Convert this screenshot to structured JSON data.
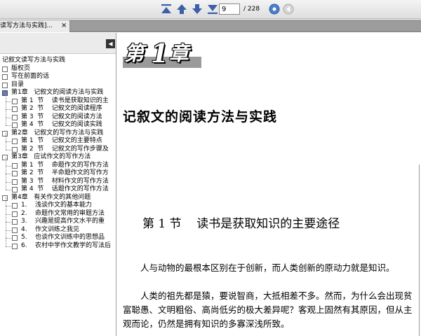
{
  "toolbar": {
    "buttons": [
      {
        "name": "first-page-icon",
        "color": "#3c5fa8"
      },
      {
        "name": "previous-page-icon",
        "color": "#3c5fa8"
      },
      {
        "name": "next-page-icon",
        "color": "#3c5fa8"
      },
      {
        "name": "last-page-icon",
        "color": "#3c5fa8"
      }
    ],
    "current_page": "9",
    "total_pages": "/ 228",
    "go_button_icon": "go-page-icon",
    "back_button_icon": "back-icon"
  },
  "tab": {
    "title": "读写方法与实践]...",
    "close_symbol": "×"
  },
  "sidebar": {
    "collapse_symbol": "◀",
    "outline": [
      {
        "text": "记叙文读写方法与实践",
        "level": 0,
        "box": false
      },
      {
        "text": "版权页",
        "level": 0,
        "box": true
      },
      {
        "text": "写在前面的话",
        "level": 0,
        "box": true
      },
      {
        "text": "目录",
        "level": 0,
        "box": true
      },
      {
        "text": "第1章   记叙文的阅读方法与实践",
        "level": 0,
        "box": true,
        "selected": true
      },
      {
        "text": "第 1  节    读书是获取知识的主",
        "level": 1,
        "box": true
      },
      {
        "text": "第 2  节    记叙文的阅读程序",
        "level": 1,
        "box": true
      },
      {
        "text": "第 3  节    记叙文的阅读方法",
        "level": 1,
        "box": true
      },
      {
        "text": "第 4  节    记叙文的阅读实践",
        "level": 1,
        "box": true
      },
      {
        "text": "第2章   记叙文的写作方法与实践",
        "level": 0,
        "box": true
      },
      {
        "text": "第 1  节    记叙文的主要特点",
        "level": 1,
        "box": true
      },
      {
        "text": "第 2  节    记叙文的写作步骤及",
        "level": 1,
        "box": true
      },
      {
        "text": "第3章   应试作文的写作方法",
        "level": 0,
        "box": true
      },
      {
        "text": "第 1  节    命题作文的写作方法",
        "level": 1,
        "box": true
      },
      {
        "text": "第 2  节    半命题作文的写作方",
        "level": 1,
        "box": true
      },
      {
        "text": "第 3  节    材料作文的写作方法",
        "level": 1,
        "box": true
      },
      {
        "text": "第 4  节    话题作文的写作方法",
        "level": 1,
        "box": true
      },
      {
        "text": "第4章   有关作文的其他问题",
        "level": 0,
        "box": true
      },
      {
        "text": "1.    浅谈作文的基本能力",
        "level": 1,
        "box": true
      },
      {
        "text": "2.    命题作文常用的审题方法",
        "level": 1,
        "box": true
      },
      {
        "text": "3.    兴趣是提高作文水平的重",
        "level": 1,
        "box": true
      },
      {
        "text": "4.    作文训练之我见",
        "level": 1,
        "box": true
      },
      {
        "text": "5.    也谈作文训练中的思想品",
        "level": 1,
        "box": true
      },
      {
        "text": "6.    农村中学作文教学的写法后",
        "level": 1,
        "box": true
      }
    ]
  },
  "document": {
    "chapter_badge": {
      "char1": "第",
      "char2": "1",
      "char3": "章"
    },
    "chapter_title": "记叙文的阅读方法与实践",
    "section_title": "第 1 节    读书是获取知识的主要途径",
    "paragraphs": [
      "人与动物的最根本区别在于创新，而人类创新的原动力就是知识。",
      "人类的祖先都是猿，要说智商，大抵相差不多。然而，为什么会出现贫富聪愚、文明粗俗、高尚低劣的极大差异呢？客观上固然有其原因，但从主观而论，仍然是拥有知识的多寡深浅所致。"
    ]
  }
}
